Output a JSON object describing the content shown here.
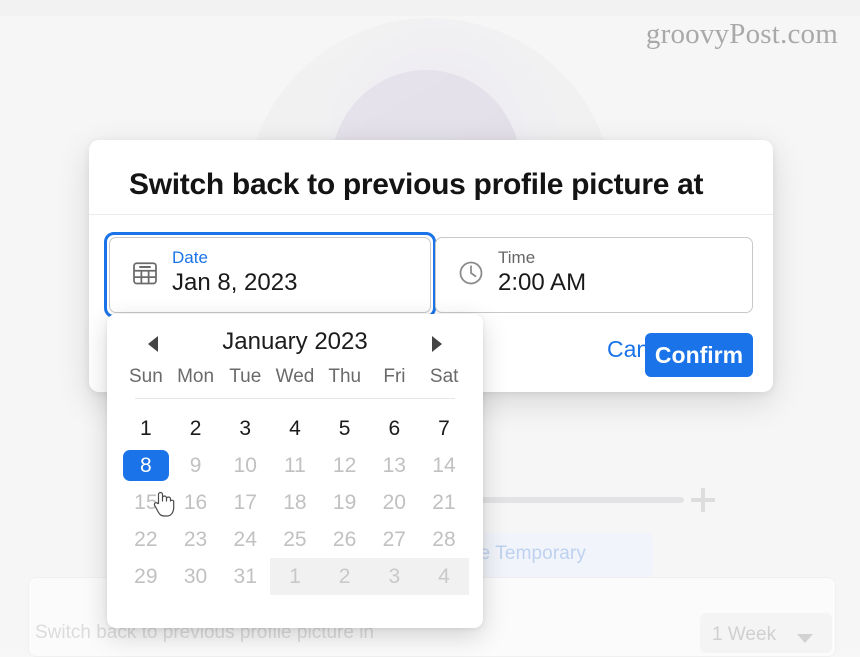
{
  "watermark": "groovyPost.com",
  "dialog": {
    "title": "Switch back to previous profile picture at",
    "date_field": {
      "icon": "calendar-icon",
      "label": "Date",
      "value": "Jan 8, 2023"
    },
    "time_field": {
      "icon": "clock-icon",
      "label": "Time",
      "value": "2:00 AM"
    },
    "cancel_label": "Cancel",
    "confirm_label": "Confirm",
    "accent_color": "#1a73e8"
  },
  "calendar": {
    "prev_icon": "chevron-left-icon",
    "next_icon": "chevron-right-icon",
    "month_label": "January 2023",
    "day_headers": [
      "Sun",
      "Mon",
      "Tue",
      "Wed",
      "Thu",
      "Fri",
      "Sat"
    ],
    "weeks": [
      [
        {
          "d": "1",
          "state": "enabled"
        },
        {
          "d": "2",
          "state": "enabled"
        },
        {
          "d": "3",
          "state": "enabled"
        },
        {
          "d": "4",
          "state": "enabled"
        },
        {
          "d": "5",
          "state": "enabled"
        },
        {
          "d": "6",
          "state": "enabled"
        },
        {
          "d": "7",
          "state": "enabled"
        }
      ],
      [
        {
          "d": "8",
          "state": "selected"
        },
        {
          "d": "9",
          "state": "disabled"
        },
        {
          "d": "10",
          "state": "disabled"
        },
        {
          "d": "11",
          "state": "disabled"
        },
        {
          "d": "12",
          "state": "disabled"
        },
        {
          "d": "13",
          "state": "disabled"
        },
        {
          "d": "14",
          "state": "disabled"
        }
      ],
      [
        {
          "d": "15",
          "state": "disabled"
        },
        {
          "d": "16",
          "state": "disabled"
        },
        {
          "d": "17",
          "state": "disabled"
        },
        {
          "d": "18",
          "state": "disabled"
        },
        {
          "d": "19",
          "state": "disabled"
        },
        {
          "d": "20",
          "state": "disabled"
        },
        {
          "d": "21",
          "state": "disabled"
        }
      ],
      [
        {
          "d": "22",
          "state": "disabled"
        },
        {
          "d": "23",
          "state": "disabled"
        },
        {
          "d": "24",
          "state": "disabled"
        },
        {
          "d": "25",
          "state": "disabled"
        },
        {
          "d": "26",
          "state": "disabled"
        },
        {
          "d": "27",
          "state": "disabled"
        },
        {
          "d": "28",
          "state": "disabled"
        }
      ],
      [
        {
          "d": "29",
          "state": "disabled"
        },
        {
          "d": "30",
          "state": "disabled"
        },
        {
          "d": "31",
          "state": "disabled"
        },
        {
          "d": "1",
          "state": "other"
        },
        {
          "d": "2",
          "state": "other"
        },
        {
          "d": "3",
          "state": "other"
        },
        {
          "d": "4",
          "state": "other"
        }
      ]
    ],
    "selected_day": "8"
  },
  "background": {
    "make_temporary_label": "ke Temporary",
    "bottom_label": "Switch back to previous profile picture in",
    "duration_value": "1 Week",
    "duration_caret": "chevron-down-icon",
    "plus_icon": "plus-icon",
    "profile_photo_alt": "profile-photo"
  }
}
